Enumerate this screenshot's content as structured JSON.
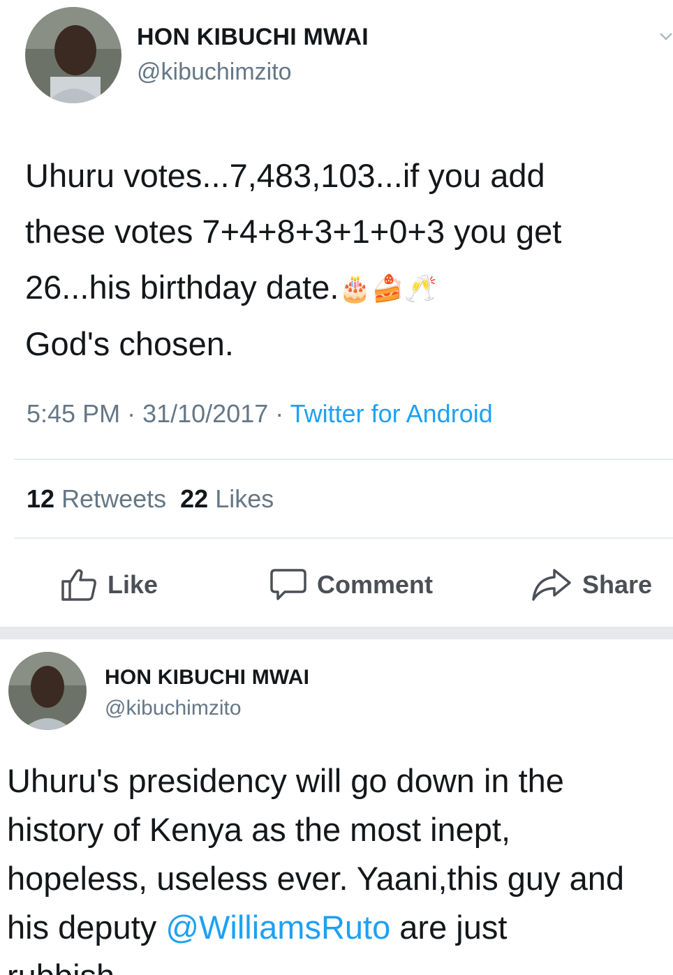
{
  "tweet1": {
    "author_name": "HON KIBUCHI MWAI",
    "handle": "@kibuchimzito",
    "text_lines": [
      "Uhuru votes...7,483,103...if you add",
      "these votes 7+4+8+3+1+0+3 you get",
      "26...his birthday date."
    ],
    "emojis": [
      "🎂",
      "🍰",
      "🥂"
    ],
    "text_last": "God's chosen.",
    "time": "5:45 PM",
    "date": "31/10/2017",
    "source": "Twitter for Android",
    "retweets_count": "12",
    "retweets_label": "Retweets",
    "likes_count": "22",
    "likes_label": "Likes"
  },
  "actions": {
    "like": "Like",
    "comment": "Comment",
    "share": "Share"
  },
  "tweet2": {
    "author_name": "HON KIBUCHI MWAI",
    "handle": "@kibuchimzito",
    "line1": "Uhuru's presidency will go down in the",
    "line2": "history of Kenya as the most inept,",
    "line3": "hopeless, useless ever. Yaani,this guy and",
    "line4_before": "his deputy ",
    "mention": "@WilliamsRuto",
    "line4_after": " are just",
    "line5": "rubbish"
  },
  "colors": {
    "link": "#1da1f2",
    "muted": "#657786",
    "text": "#14171a",
    "separator": "#e6e8eb"
  },
  "icons": [
    "chevron-down-icon",
    "thumbs-up-icon",
    "comment-bubble-icon",
    "share-arrow-icon"
  ]
}
